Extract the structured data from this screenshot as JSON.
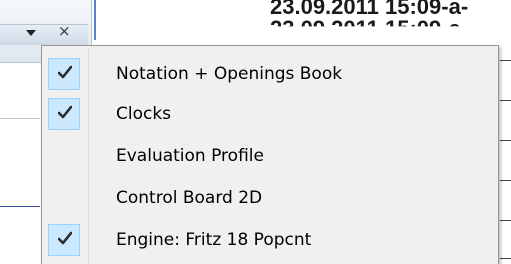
{
  "background": {
    "timestamp_line_1": "23.09.2011 15:09-a-",
    "timestamp_line_2": "23.09.2011 15:09-a-",
    "header_close_glyph": "×"
  },
  "menu": {
    "items": [
      {
        "label": "Notation + Openings Book",
        "checked": true
      },
      {
        "label": "Clocks",
        "checked": true
      },
      {
        "label": "Evaluation Profile",
        "checked": false
      },
      {
        "label": "Control Board 2D",
        "checked": false
      },
      {
        "label": "Engine: Fritz 18 Popcnt",
        "checked": true
      }
    ]
  },
  "colors": {
    "menu_background": "#f0f0f0",
    "check_highlight": "#cce8ff",
    "check_border": "#99d1ff",
    "accent_line": "#5a7fd6"
  }
}
